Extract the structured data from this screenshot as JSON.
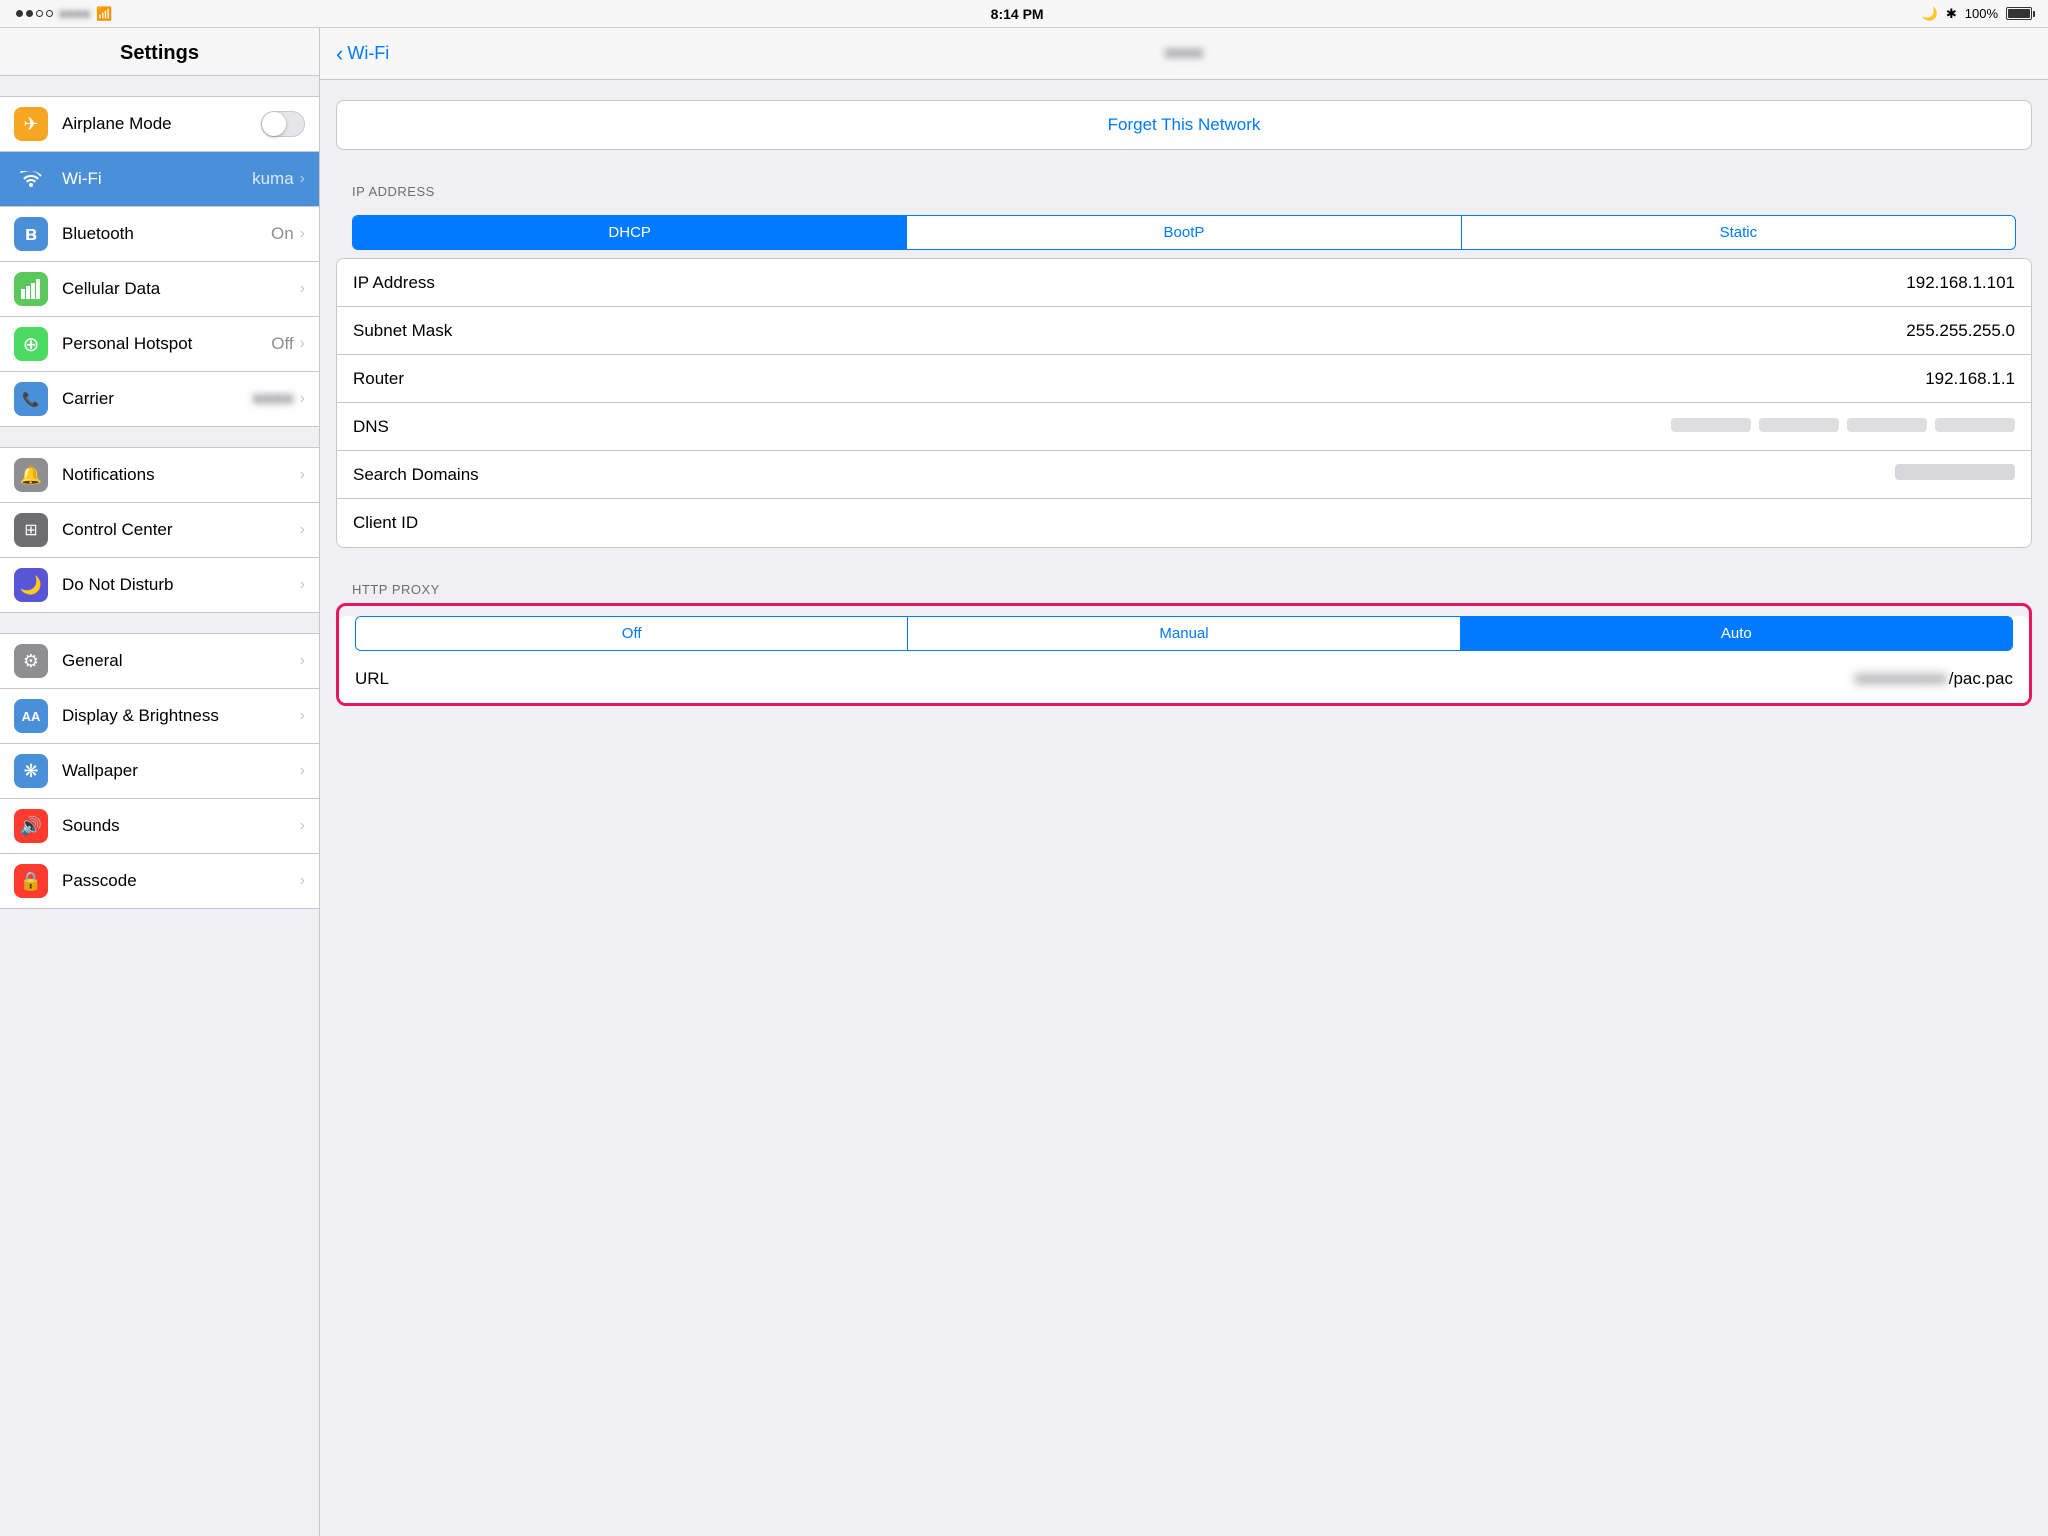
{
  "statusBar": {
    "time": "8:14 PM",
    "battery": "100%"
  },
  "sidebar": {
    "title": "Settings",
    "sections": [
      {
        "items": [
          {
            "id": "airplane",
            "label": "Airplane Mode",
            "icon": "✈",
            "iconClass": "icon-orange",
            "hasToggle": true,
            "toggleOn": false,
            "value": ""
          },
          {
            "id": "wifi",
            "label": "Wi-Fi",
            "icon": "wifi",
            "iconClass": "icon-blue",
            "hasToggle": false,
            "value": "kuma",
            "active": true
          },
          {
            "id": "bluetooth",
            "label": "Bluetooth",
            "icon": "bt",
            "iconClass": "icon-blue",
            "hasToggle": false,
            "value": "On"
          },
          {
            "id": "cellular",
            "label": "Cellular Data",
            "icon": "cell",
            "iconClass": "icon-green-cell",
            "hasToggle": false,
            "value": ""
          },
          {
            "id": "hotspot",
            "label": "Personal Hotspot",
            "icon": "♾",
            "iconClass": "icon-green-hotspot",
            "hasToggle": false,
            "value": "Off"
          },
          {
            "id": "carrier",
            "label": "Carrier",
            "icon": "📶",
            "iconClass": "icon-blue",
            "hasToggle": false,
            "value": "blurred"
          }
        ]
      },
      {
        "items": [
          {
            "id": "notifications",
            "label": "Notifications",
            "icon": "🔔",
            "iconClass": "icon-gray",
            "hasToggle": false,
            "value": ""
          },
          {
            "id": "control",
            "label": "Control Center",
            "icon": "⊞",
            "iconClass": "icon-dark-gray",
            "hasToggle": false,
            "value": ""
          },
          {
            "id": "disturb",
            "label": "Do Not Disturb",
            "icon": "🌙",
            "iconClass": "icon-purple",
            "hasToggle": false,
            "value": ""
          }
        ]
      },
      {
        "items": [
          {
            "id": "general",
            "label": "General",
            "icon": "⚙",
            "iconClass": "icon-light-gray",
            "hasToggle": false,
            "value": ""
          },
          {
            "id": "display",
            "label": "Display & Brightness",
            "icon": "AA",
            "iconClass": "icon-blue",
            "hasToggle": false,
            "value": ""
          },
          {
            "id": "wallpaper",
            "label": "Wallpaper",
            "icon": "❋",
            "iconClass": "icon-blue",
            "hasToggle": false,
            "value": ""
          },
          {
            "id": "sounds",
            "label": "Sounds",
            "icon": "🔊",
            "iconClass": "icon-orange-sound",
            "hasToggle": false,
            "value": ""
          },
          {
            "id": "passcode",
            "label": "Passcode",
            "icon": "🔒",
            "iconClass": "icon-orange-sound",
            "hasToggle": false,
            "value": ""
          }
        ]
      }
    ]
  },
  "detail": {
    "backLabel": "Wi-Fi",
    "networkName": "kuma",
    "forgetButton": "Forget This Network",
    "ipAddress": {
      "sectionLabel": "IP ADDRESS",
      "tabs": [
        "DHCP",
        "BootP",
        "Static"
      ],
      "activeTab": "DHCP",
      "fields": [
        {
          "label": "IP Address",
          "value": "192.168.1.101",
          "blurred": false
        },
        {
          "label": "Subnet Mask",
          "value": "255.255.255.0",
          "blurred": false
        },
        {
          "label": "Router",
          "value": "192.168.1.1",
          "blurred": false
        },
        {
          "label": "DNS",
          "value": "blurred",
          "blurred": true
        },
        {
          "label": "Search Domains",
          "value": "blurred",
          "blurred": true
        },
        {
          "label": "Client ID",
          "value": "",
          "blurred": false
        }
      ]
    },
    "httpProxy": {
      "sectionLabel": "HTTP PROXY",
      "tabs": [
        "Off",
        "Manual",
        "Auto"
      ],
      "activeTab": "Auto",
      "fields": [
        {
          "label": "URL",
          "value": "blurred/pac.pac",
          "blurred": true
        }
      ]
    }
  }
}
